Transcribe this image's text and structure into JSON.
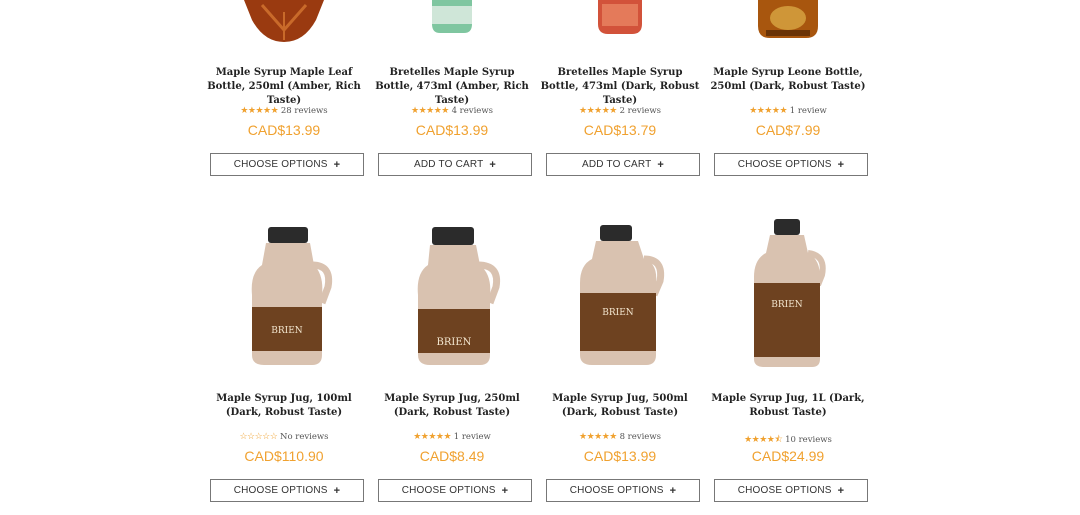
{
  "products_top": [
    {
      "title": "Maple Syrup Maple Leaf Bottle, 250ml (Amber, Rich Taste)",
      "rating_stars": "★★★★★",
      "rating_text": "28 reviews",
      "price": "CAD$13.99",
      "button": "CHOOSE OPTIONS"
    },
    {
      "title": "Bretelles Maple Syrup Bottle, 473ml (Amber, Rich Taste)",
      "rating_stars": "★★★★★",
      "rating_text": "4 reviews",
      "price": "CAD$13.99",
      "button": "ADD TO CART"
    },
    {
      "title": "Bretelles Maple Syrup Bottle, 473ml (Dark, Robust Taste)",
      "rating_stars": "★★★★★",
      "rating_text": "2 reviews",
      "price": "CAD$13.79",
      "button": "ADD TO CART"
    },
    {
      "title": "Maple Syrup Leone Bottle, 250ml (Dark, Robust Taste)",
      "rating_stars": "★★★★★",
      "rating_text": "1 review",
      "price": "CAD$7.99",
      "button": "CHOOSE OPTIONS"
    }
  ],
  "products_bottom": [
    {
      "title": "Maple Syrup Jug, 100ml (Dark, Robust Taste)",
      "rating_stars": "☆☆☆☆☆",
      "rating_text": "No reviews",
      "price": "CAD$110.90",
      "button": "CHOOSE OPTIONS"
    },
    {
      "title": "Maple Syrup Jug, 250ml (Dark, Robust Taste)",
      "rating_stars": "★★★★★",
      "rating_text": "1 review",
      "price": "CAD$8.49",
      "button": "CHOOSE OPTIONS"
    },
    {
      "title": "Maple Syrup Jug, 500ml (Dark, Robust Taste)",
      "rating_stars": "★★★★★",
      "rating_text": "8 reviews",
      "price": "CAD$13.99",
      "button": "CHOOSE OPTIONS"
    },
    {
      "title": "Maple Syrup Jug, 1L (Dark, Robust Taste)",
      "rating_stars": "★★★★⯪",
      "rating_text": "10 reviews",
      "price": "CAD$24.99",
      "button": "CHOOSE OPTIONS"
    }
  ],
  "jug_label": "BRIEN",
  "colors": {
    "accent": "#f0a12f",
    "text": "#222222",
    "border": "#777777"
  },
  "icons": {
    "button_plus": "plus-icon",
    "rating": "star-icon"
  }
}
